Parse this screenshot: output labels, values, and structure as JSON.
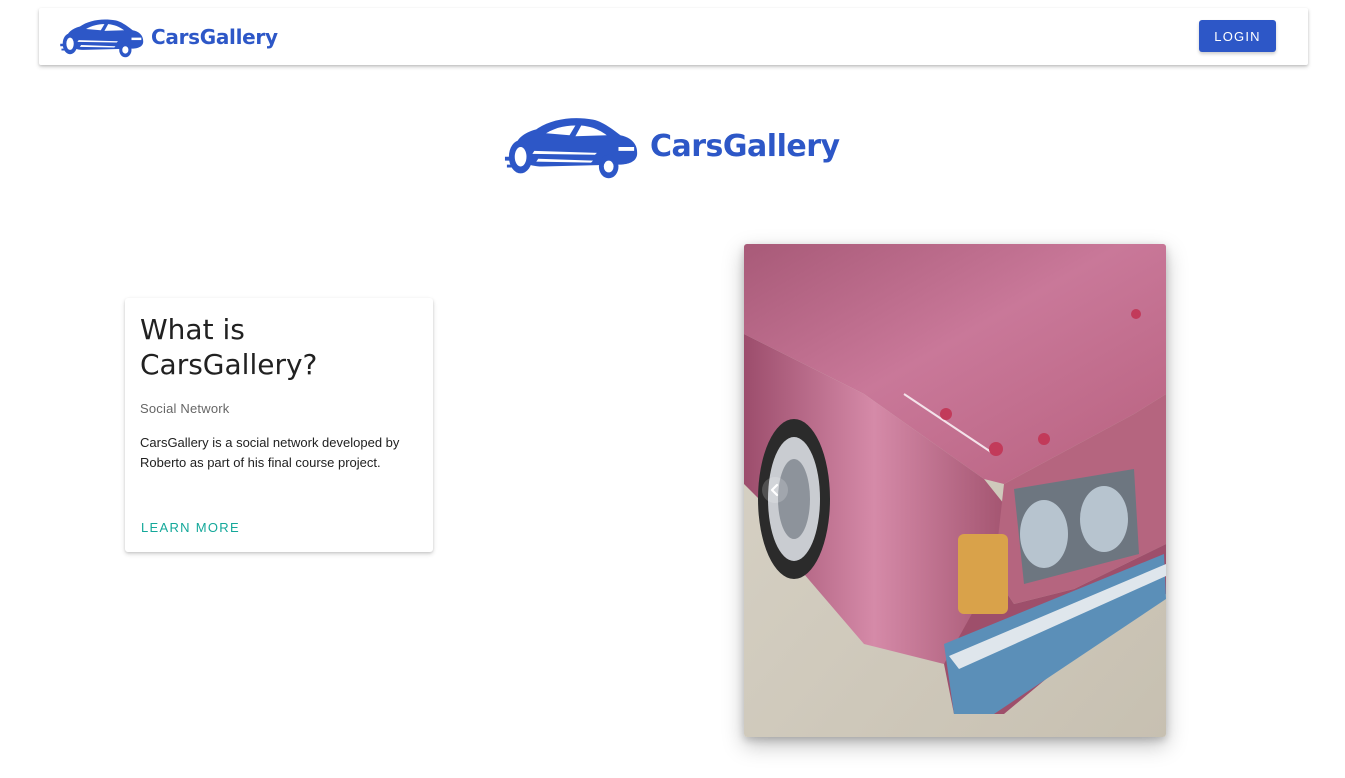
{
  "colors": {
    "brand": "#2d57c7",
    "accent": "#14a89a"
  },
  "navbar": {
    "brand_name": "CarsGallery",
    "login_label": "LOGIN"
  },
  "hero": {
    "brand_name": "CarsGallery"
  },
  "card": {
    "title": "What is CarsGallery?",
    "subtitle": "Social Network",
    "text": "CarsGallery is a social network developed by Roberto  as part of his final course project.",
    "action_label": "LEARN MORE"
  },
  "carousel": {
    "prev_icon": "chevron-left-icon",
    "image_subject": "pink-car-photo"
  }
}
